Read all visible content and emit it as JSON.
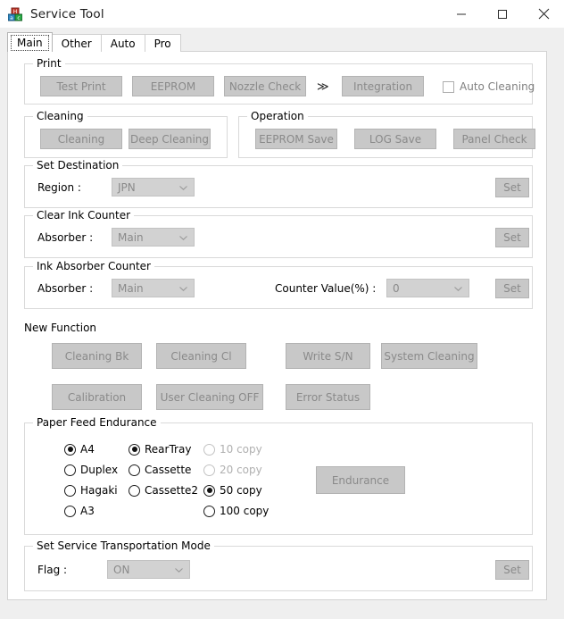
{
  "window": {
    "title": "Service Tool",
    "icon": "app-blocks-icon",
    "controls": {
      "minimize": "minimize-icon",
      "maximize": "maximize-icon",
      "close": "close-icon"
    }
  },
  "tabs": [
    {
      "label": "Main",
      "active": true
    },
    {
      "label": "Other",
      "active": false
    },
    {
      "label": "Auto",
      "active": false
    },
    {
      "label": "Pro",
      "active": false
    }
  ],
  "groups": {
    "print": {
      "legend": "Print",
      "buttons": [
        {
          "label": "Test Print"
        },
        {
          "label": "EEPROM"
        },
        {
          "label": "Nozzle Check"
        },
        {
          "label": "Integration"
        }
      ],
      "separator": "≫",
      "checkbox": {
        "label": "Auto Cleaning",
        "checked": false
      }
    },
    "cleaning": {
      "legend": "Cleaning",
      "buttons": [
        {
          "label": "Cleaning"
        },
        {
          "label": "Deep Cleaning"
        }
      ]
    },
    "operation": {
      "legend": "Operation",
      "buttons": [
        {
          "label": "EEPROM Save"
        },
        {
          "label": "LOG Save"
        },
        {
          "label": "Panel Check"
        }
      ]
    },
    "set_destination": {
      "legend": "Set Destination",
      "field_label": "Region :",
      "value": "JPN",
      "set_label": "Set"
    },
    "clear_ink_counter": {
      "legend": "Clear Ink Counter",
      "field_label": "Absorber :",
      "value": "Main",
      "set_label": "Set"
    },
    "ink_absorber_counter": {
      "legend": "Ink Absorber Counter",
      "field_label": "Absorber :",
      "value": "Main",
      "counter_label": "Counter Value(%) :",
      "counter_value": "0",
      "set_label": "Set"
    },
    "new_function": {
      "legend": "New Function",
      "buttons": [
        {
          "label": "Cleaning Bk"
        },
        {
          "label": "Cleaning Cl"
        },
        {
          "label": "Write S/N"
        },
        {
          "label": "System Cleaning"
        },
        {
          "label": "Calibration"
        },
        {
          "label": "User Cleaning OFF"
        },
        {
          "label": "Error Status"
        }
      ]
    },
    "paper_feed_endurance": {
      "legend": "Paper Feed Endurance",
      "paper_sizes": [
        {
          "label": "A4",
          "checked": true,
          "disabled": false
        },
        {
          "label": "Duplex",
          "checked": false,
          "disabled": false
        },
        {
          "label": "Hagaki",
          "checked": false,
          "disabled": false
        },
        {
          "label": "A3",
          "checked": false,
          "disabled": false
        }
      ],
      "sources": [
        {
          "label": "RearTray",
          "checked": true,
          "disabled": false
        },
        {
          "label": "Cassette",
          "checked": false,
          "disabled": false
        },
        {
          "label": "Cassette2",
          "checked": false,
          "disabled": false
        }
      ],
      "copies": [
        {
          "label": "10 copy",
          "checked": false,
          "disabled": true
        },
        {
          "label": "20 copy",
          "checked": false,
          "disabled": true
        },
        {
          "label": "50 copy",
          "checked": true,
          "disabled": false
        },
        {
          "label": "100 copy",
          "checked": false,
          "disabled": false
        }
      ],
      "action_label": "Endurance"
    },
    "service_transportation": {
      "legend": "Set Service Transportation Mode",
      "field_label": "Flag :",
      "value": "ON",
      "set_label": "Set"
    }
  },
  "colors": {
    "window_bg": "#ffffff",
    "panel_bg": "#efefef",
    "button_face": "#c8c8c8",
    "button_text_disabled": "#8a8a8a",
    "combo_face": "#d2d2d2",
    "group_border": "#d9d9d9",
    "text": "#000000"
  }
}
